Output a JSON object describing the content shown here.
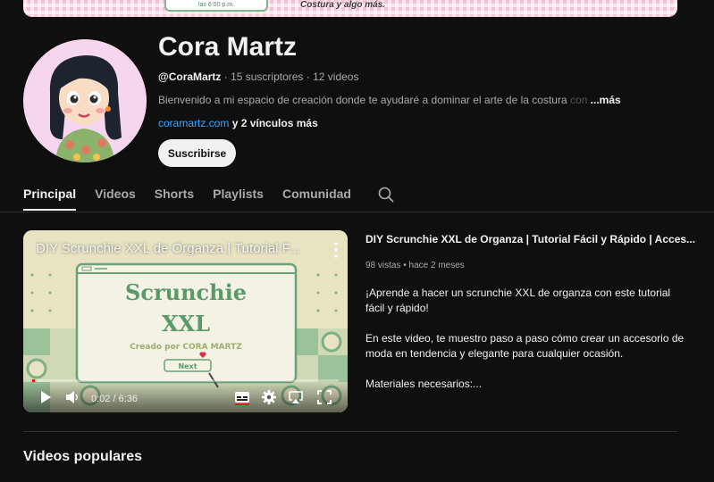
{
  "banner": {
    "card_text": "las 6:00 p.m.",
    "tagline": "Costura y algo más."
  },
  "channel": {
    "name": "Cora Martz",
    "handle": "@CoraMartz",
    "subscribers": "15 suscriptores",
    "videos_count": "12 videos",
    "separator": " · ",
    "description": "Bienvenido a mi espacio de creación donde te ayudaré a dominar el arte de la costura",
    "description_fade": " con",
    "more_label": "...más",
    "link": "coramartz.com",
    "more_links": " y 2 vínculos más",
    "subscribe_label": "Suscribirse"
  },
  "tabs": [
    {
      "label": "Principal",
      "active": true
    },
    {
      "label": "Videos"
    },
    {
      "label": "Shorts"
    },
    {
      "label": "Playlists"
    },
    {
      "label": "Comunidad"
    }
  ],
  "featured": {
    "player_title": "DIY Scrunchie XXL de Organza | Tutorial F...",
    "thumb_line1": "Scrunchie",
    "thumb_line2": "XXL",
    "thumb_credit": "Creado por CORA MARTZ",
    "thumb_button": "Next",
    "time": "0:02 / 6:36",
    "progress": 0.005,
    "title": "DIY Scrunchie XXL de Organza | Tutorial Fácil y Rápido | Acces...",
    "views": "98 vistas",
    "ago": "hace 2 meses",
    "meta_separator": " • ",
    "desc_p1": "¡Aprende a hacer un scrunchie XXL de organza con este tutorial fácil y rápido!",
    "desc_p2": "En este video, te muestro paso a paso cómo crear un accesorio de moda en tendencia y elegante para cualquier ocasión.",
    "desc_p3": "Materiales necesarios:..."
  },
  "sections": {
    "popular_title": "Videos populares"
  },
  "colors": {
    "background": "#0f0f0f",
    "link": "#3ea6ff",
    "progress": "#ff0000",
    "thumb_text": "#5a9a68"
  },
  "icons": {
    "search": "search-icon",
    "play": "play-icon",
    "volume": "volume-icon",
    "subtitles": "subtitles-icon",
    "settings": "gear-icon",
    "airplay": "airplay-icon",
    "fullscreen": "fullscreen-icon",
    "more": "kebab-icon"
  }
}
